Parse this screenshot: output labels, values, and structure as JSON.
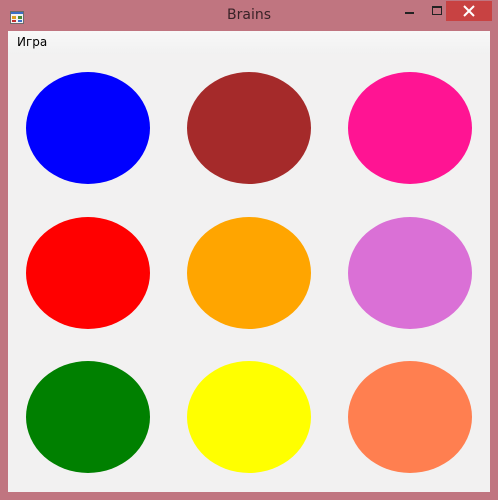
{
  "window": {
    "title": "Brains"
  },
  "menu": {
    "items": [
      {
        "label": "Игра"
      }
    ]
  },
  "circles": [
    {
      "color": "#0000ff"
    },
    {
      "color": "#a52a2a"
    },
    {
      "color": "#ff1493"
    },
    {
      "color": "#ff0000"
    },
    {
      "color": "#ffa500"
    },
    {
      "color": "#da70d6"
    },
    {
      "color": "#008000"
    },
    {
      "color": "#ffff00"
    },
    {
      "color": "#ff7f50"
    }
  ],
  "icons": {
    "app": "application-icon",
    "minimize": "minimize-icon",
    "maximize": "maximize-icon",
    "close": "close-icon"
  }
}
